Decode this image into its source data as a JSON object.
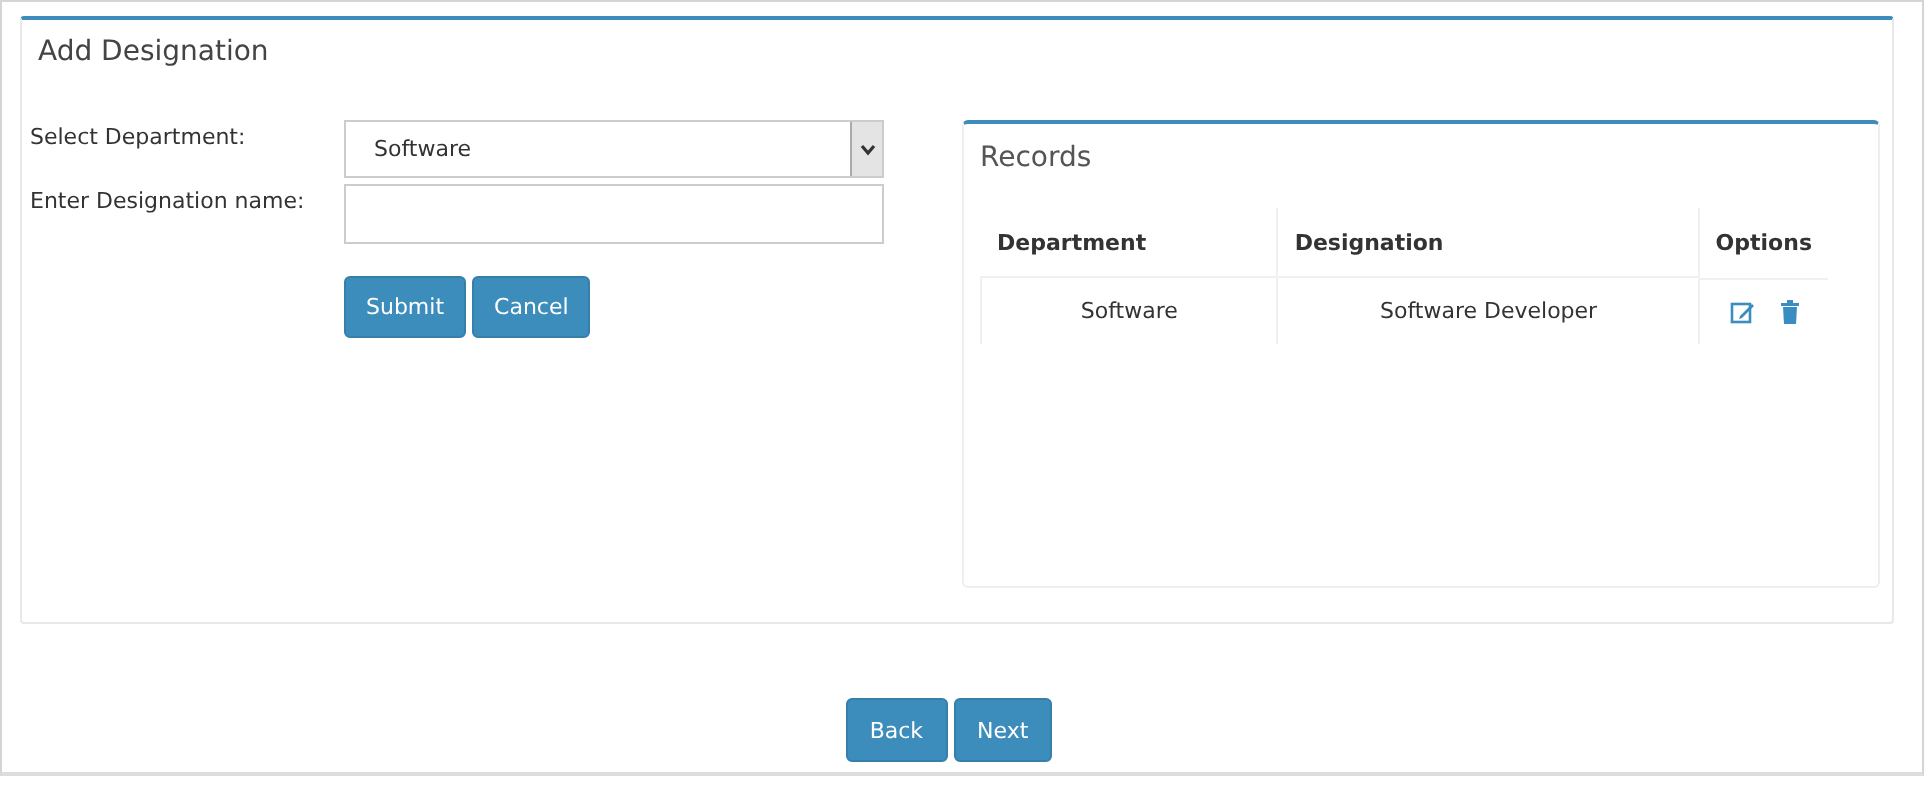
{
  "panel": {
    "title": "Add Designation"
  },
  "form": {
    "department_label": "Select Department:",
    "department_value": "Software",
    "designation_label": "Enter Designation name:",
    "buttons": [
      "Submit",
      "Cancel"
    ]
  },
  "records": {
    "title": "Records",
    "columns": [
      "Department",
      "Designation",
      "Options"
    ],
    "rows": [
      {
        "department": "Software",
        "designation": "Software Developer"
      }
    ]
  },
  "footer_buttons": [
    "Back",
    "Next"
  ]
}
